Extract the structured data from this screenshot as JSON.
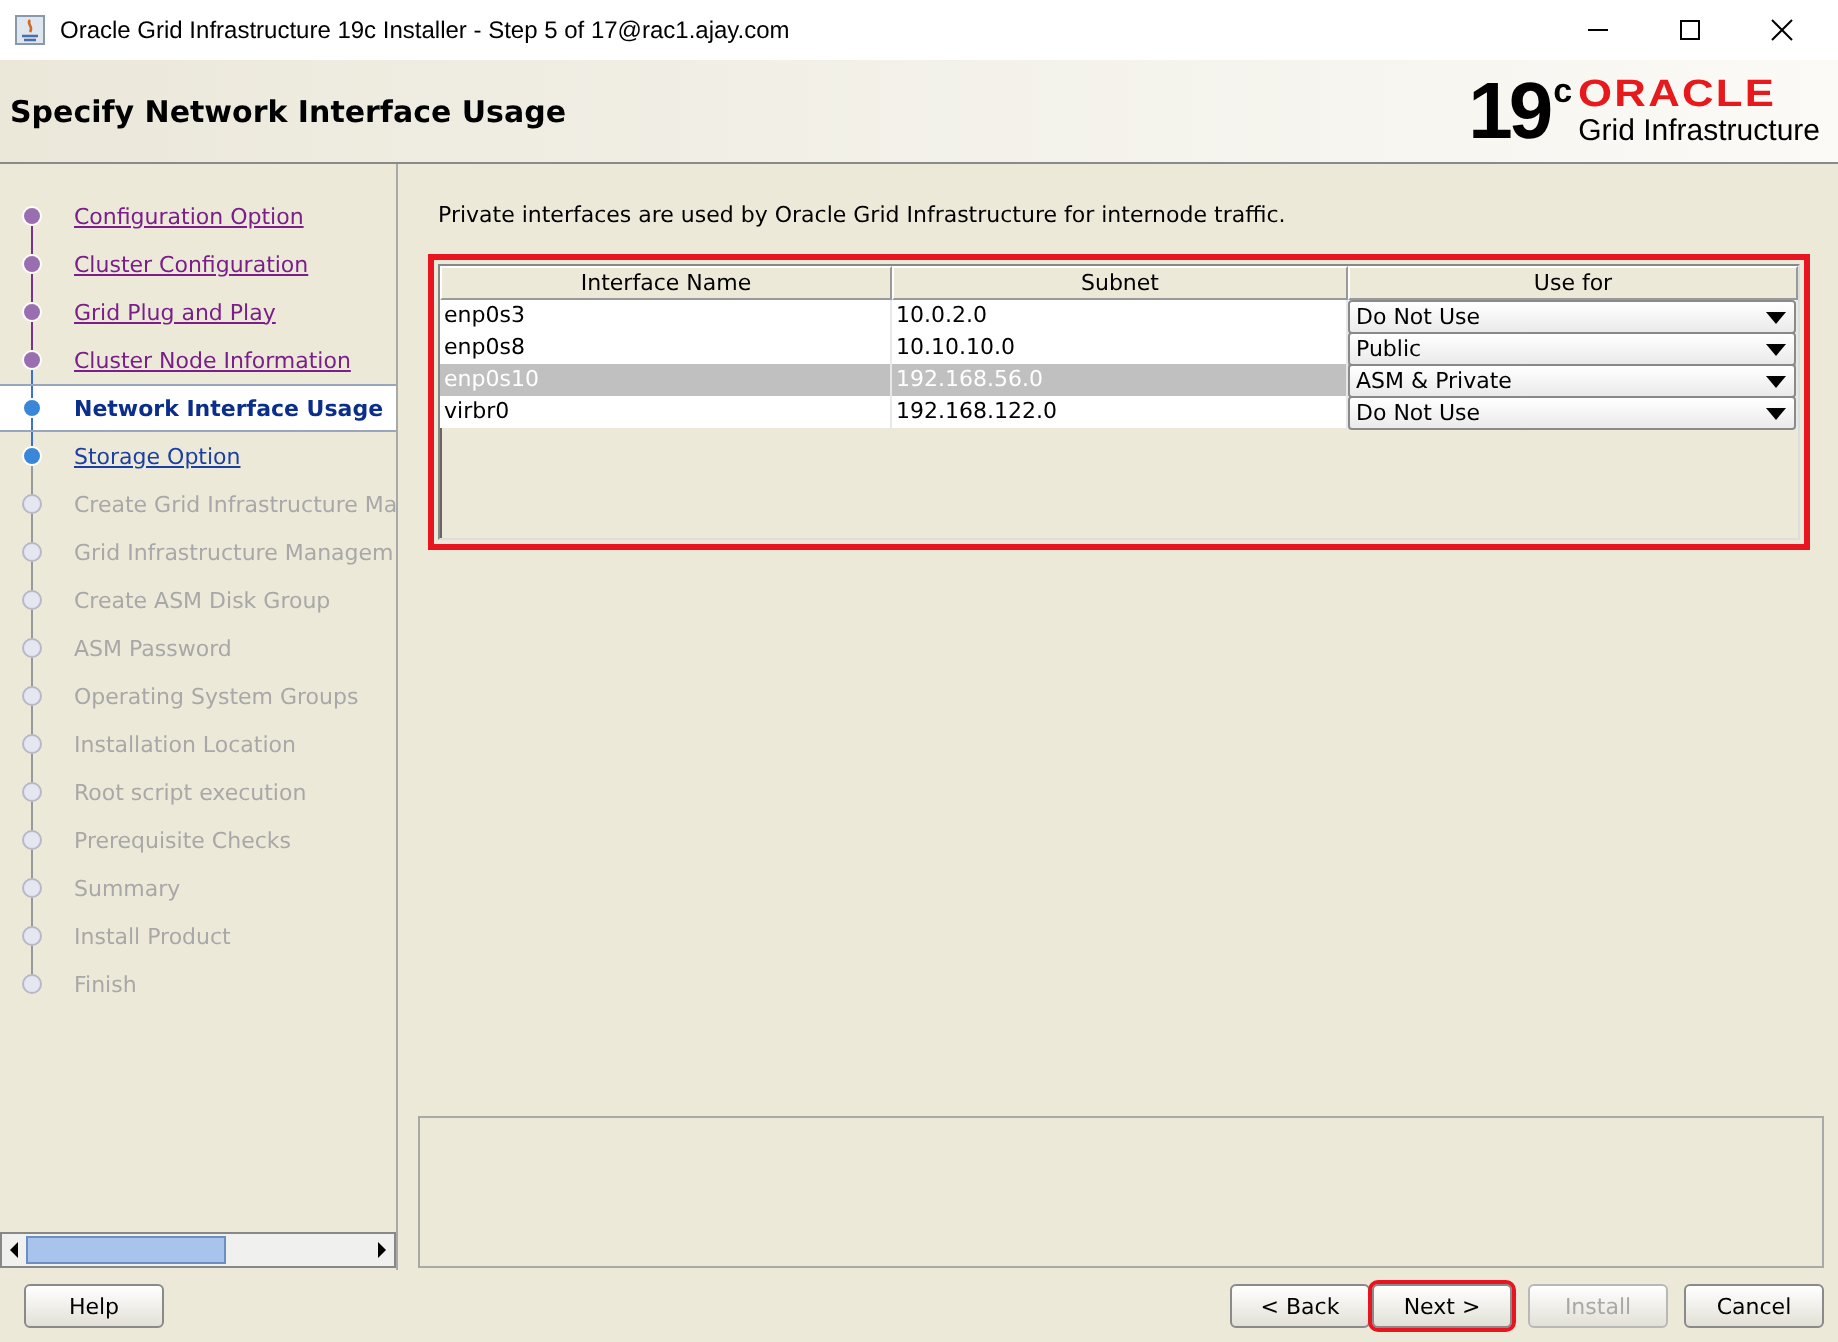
{
  "window": {
    "title": "Oracle Grid Infrastructure 19c Installer - Step 5 of 17@rac1.ajay.com"
  },
  "header": {
    "title": "Specify Network Interface Usage",
    "logo_version": "19",
    "logo_superscript": "c",
    "logo_brand": "ORACLE",
    "logo_product": "Grid Infrastructure"
  },
  "steps": [
    {
      "label": "Configuration Option",
      "kind": "done"
    },
    {
      "label": "Cluster Configuration",
      "kind": "done"
    },
    {
      "label": "Grid Plug and Play",
      "kind": "done"
    },
    {
      "label": "Cluster Node Information",
      "kind": "done"
    },
    {
      "label": "Network Interface Usage",
      "kind": "current"
    },
    {
      "label": "Storage Option",
      "kind": "next"
    },
    {
      "label": "Create Grid Infrastructure Ma",
      "kind": "pending"
    },
    {
      "label": "Grid Infrastructure Managem",
      "kind": "pending"
    },
    {
      "label": "Create ASM Disk Group",
      "kind": "pending"
    },
    {
      "label": "ASM Password",
      "kind": "pending"
    },
    {
      "label": "Operating System Groups",
      "kind": "pending"
    },
    {
      "label": "Installation Location",
      "kind": "pending"
    },
    {
      "label": "Root script execution",
      "kind": "pending"
    },
    {
      "label": "Prerequisite Checks",
      "kind": "pending"
    },
    {
      "label": "Summary",
      "kind": "pending"
    },
    {
      "label": "Install Product",
      "kind": "pending"
    },
    {
      "label": "Finish",
      "kind": "pending"
    }
  ],
  "description": "Private interfaces are used by Oracle Grid Infrastructure for internode traffic.",
  "table": {
    "highlighted": true,
    "columns": [
      "Interface Name",
      "Subnet",
      "Use for"
    ],
    "rows": [
      {
        "name": "enp0s3",
        "subnet": "10.0.2.0",
        "use_for": "Do Not Use",
        "selected": false
      },
      {
        "name": "enp0s8",
        "subnet": "10.10.10.0",
        "use_for": "Public",
        "selected": false
      },
      {
        "name": "enp0s10",
        "subnet": "192.168.56.0",
        "use_for": "ASM & Private",
        "selected": true
      },
      {
        "name": "virbr0",
        "subnet": "192.168.122.0",
        "use_for": "Do Not Use",
        "selected": false
      }
    ]
  },
  "buttons": [
    {
      "label": "Help",
      "kind": "help",
      "disabled": false,
      "highlighted": false
    },
    {
      "label": "< Back",
      "kind": "nav",
      "disabled": false,
      "highlighted": false
    },
    {
      "label": "Next >",
      "kind": "nav",
      "disabled": false,
      "highlighted": true
    },
    {
      "label": "Install",
      "kind": "nav",
      "disabled": true,
      "highlighted": false
    },
    {
      "label": "Cancel",
      "kind": "cancel",
      "disabled": false,
      "highlighted": false
    }
  ]
}
